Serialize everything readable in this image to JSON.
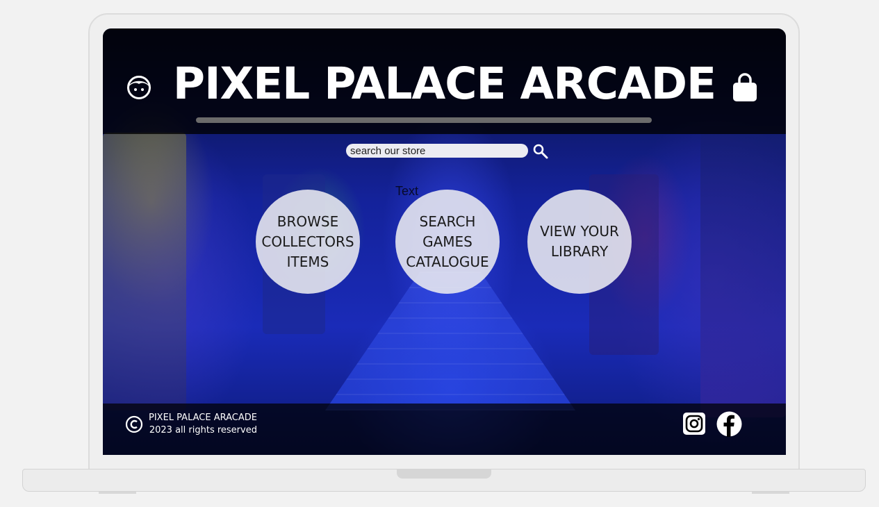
{
  "brand": {
    "title": "PIXEL PALACE ARCADE"
  },
  "icons": {
    "profile": "avatar-face-icon",
    "cart": "shopping-bag-icon",
    "search": "search-icon",
    "copyright": "copyright-icon",
    "instagram": "instagram-icon",
    "facebook": "facebook-icon"
  },
  "search": {
    "placeholder": "search our store",
    "value": ""
  },
  "stray_text": "Text",
  "nav": {
    "items": [
      {
        "label": "BROWSE\nCOLLECTORS\nITEMS"
      },
      {
        "label": "SEARCH\nGAMES\nCATALOGUE"
      },
      {
        "label": "VIEW YOUR\nLIBRARY"
      }
    ]
  },
  "footer": {
    "line1": "PIXEL PALACE ARACADE",
    "line2": "2023 all rights reserved"
  },
  "colors": {
    "page_bg": "#f2f2f2",
    "band": "#000000",
    "button_bg": "#ebebf0",
    "text_light": "#ffffff",
    "accent_blue": "#1a2bb8"
  }
}
